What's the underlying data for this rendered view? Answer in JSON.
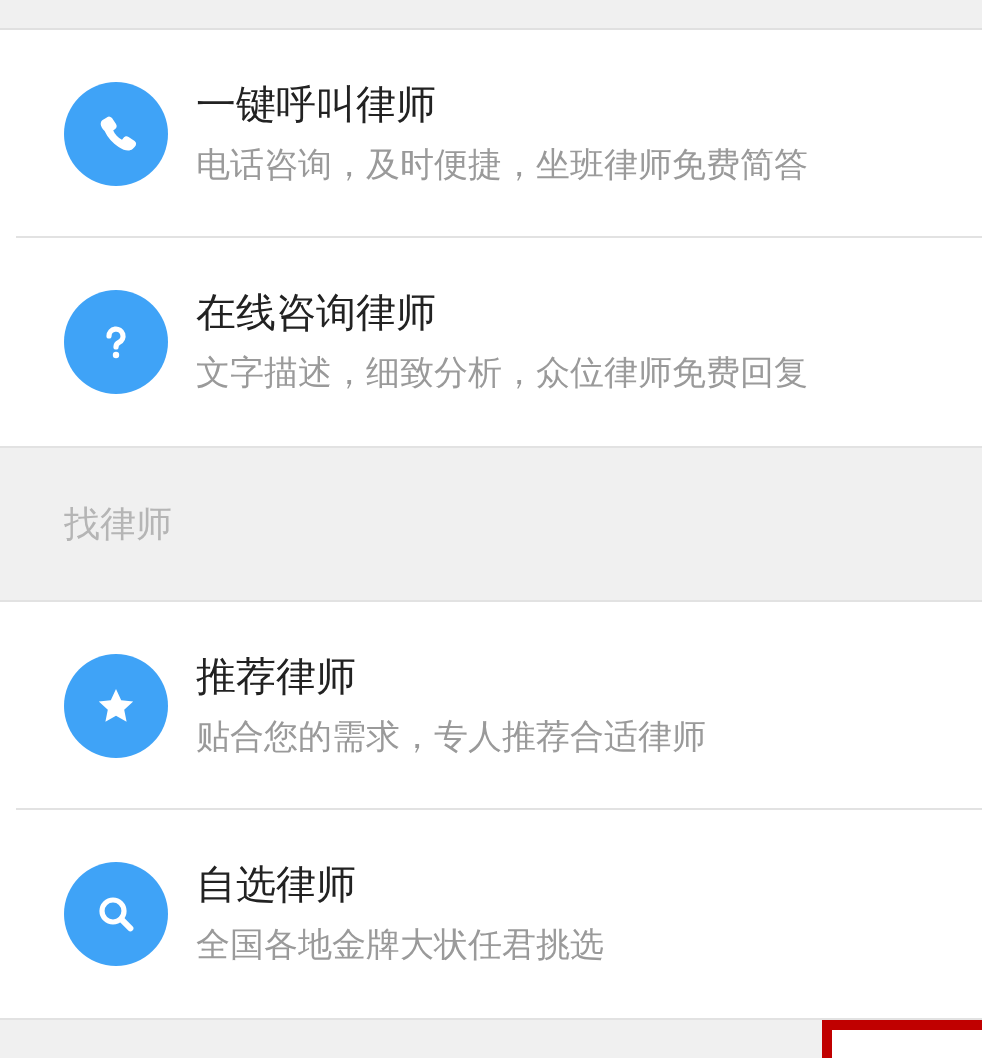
{
  "sections": [
    {
      "items": [
        {
          "kind": "phone",
          "title": "一键呼叫律师",
          "subtitle": "电话咨询，及时便捷，坐班律师免费简答"
        },
        {
          "kind": "question",
          "title": "在线咨询律师",
          "subtitle": "文字描述，细致分析，众位律师免费回复"
        }
      ]
    },
    {
      "header": "找律师",
      "items": [
        {
          "kind": "star",
          "title": "推荐律师",
          "subtitle": "贴合您的需求，专人推荐合适律师"
        },
        {
          "kind": "search",
          "title": "自选律师",
          "subtitle": "全国各地金牌大状任君挑选"
        }
      ]
    }
  ]
}
